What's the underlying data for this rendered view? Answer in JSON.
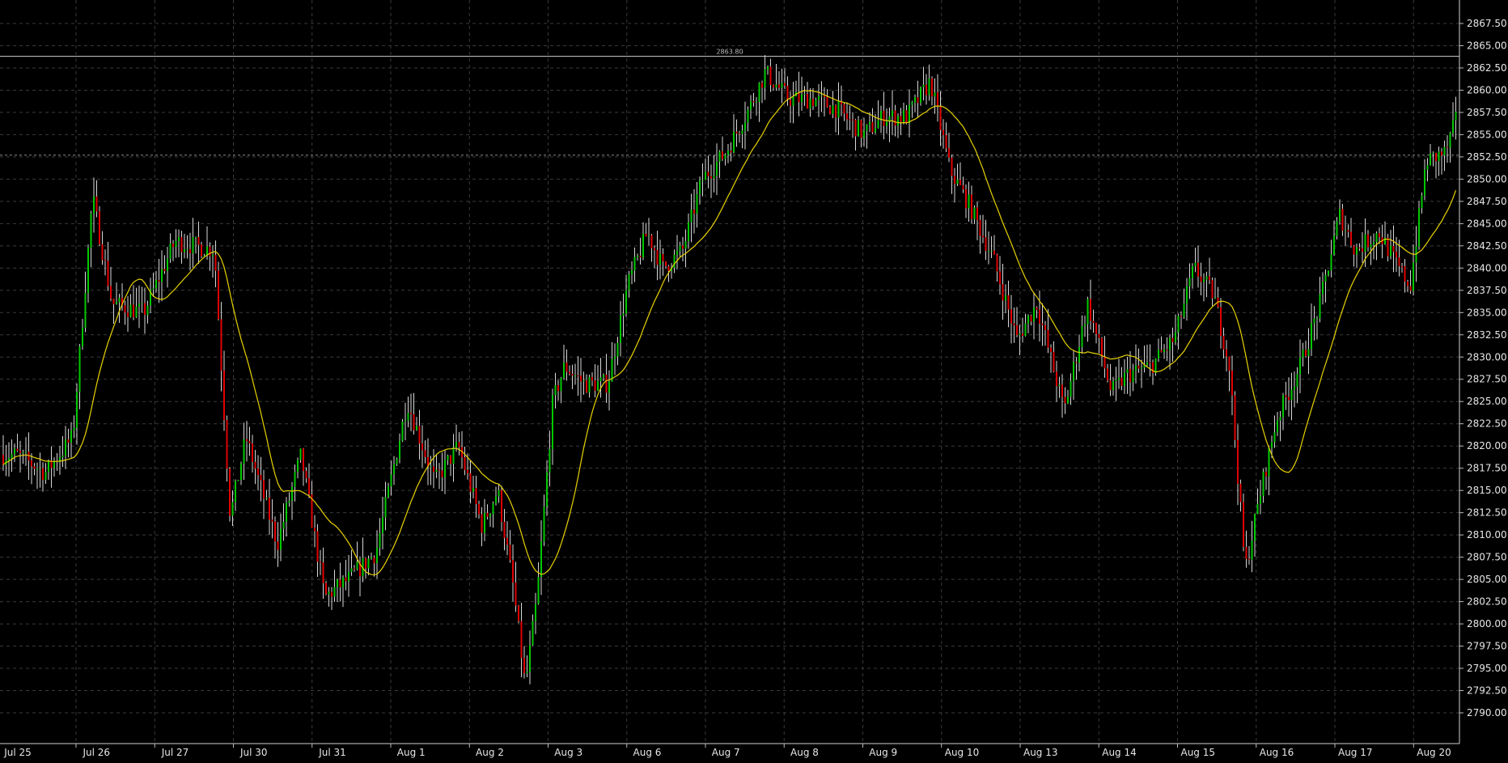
{
  "chart_data": {
    "type": "candlestick",
    "title": "",
    "xlabel": "",
    "ylabel": "",
    "ylim": [
      2787.5,
      2867.5
    ],
    "y_ticks": [
      2790.0,
      2792.5,
      2795.0,
      2797.5,
      2800.0,
      2802.5,
      2805.0,
      2807.5,
      2810.0,
      2812.5,
      2815.0,
      2817.5,
      2820.0,
      2822.5,
      2825.0,
      2827.5,
      2830.0,
      2832.5,
      2835.0,
      2837.5,
      2840.0,
      2842.5,
      2845.0,
      2847.5,
      2850.0,
      2852.5,
      2855.0,
      2857.5,
      2860.0,
      2862.5,
      2865.0,
      2867.5
    ],
    "y_tick_labels": [
      "2790.00",
      "2792.50",
      "2795.00",
      "2797.50",
      "2800.00",
      "2802.50",
      "2805.00",
      "2807.50",
      "2810.00",
      "2812.50",
      "2815.00",
      "2817.50",
      "2820.00",
      "2822.50",
      "2825.00",
      "2827.50",
      "2830.00",
      "2832.50",
      "2835.00",
      "2837.50",
      "2840.00",
      "2842.50",
      "2845.00",
      "2847.50",
      "2850.00",
      "2852.50",
      "2855.00",
      "2857.50",
      "2860.00",
      "2862.50",
      "2865.00",
      "2867.50"
    ],
    "x_labels": [
      "Jul 25",
      "Jul 26",
      "Jul 27",
      "Jul 30",
      "Jul 31",
      "Aug 1",
      "Aug 2",
      "Aug 3",
      "Aug 6",
      "Aug 7",
      "Aug 8",
      "Aug 9",
      "Aug 10",
      "Aug 13",
      "Aug 14",
      "Aug 15",
      "Aug 16",
      "Aug 17",
      "Aug 20"
    ],
    "reference_line": {
      "value": 2863.8,
      "label": "2863.80"
    },
    "dashed_line": {
      "value": 2852.7
    },
    "grid": true,
    "colors": {
      "background": "#000000",
      "grid": "#3a3a3a",
      "up": "#00c800",
      "down": "#e00000",
      "wick": "#d8d8d8",
      "ma": "#e8d200",
      "axis_text": "#e6e6e6",
      "reference": "#cfcfcf"
    },
    "price_path": [
      [
        0,
        2819
      ],
      [
        0.35,
        2817
      ],
      [
        0.7,
        2821
      ],
      [
        0.95,
        2848
      ],
      [
        1.2,
        2836
      ],
      [
        1.6,
        2835
      ],
      [
        2.0,
        2843
      ],
      [
        2.5,
        2842
      ],
      [
        2.7,
        2812
      ],
      [
        2.9,
        2821
      ],
      [
        3.3,
        2809
      ],
      [
        3.6,
        2819
      ],
      [
        3.9,
        2803
      ],
      [
        4.2,
        2805
      ],
      [
        4.55,
        2808
      ],
      [
        4.95,
        2825
      ],
      [
        5.3,
        2816
      ],
      [
        5.6,
        2820
      ],
      [
        5.9,
        2811
      ],
      [
        6.1,
        2815
      ],
      [
        6.3,
        2804
      ],
      [
        6.45,
        2793
      ],
      [
        6.6,
        2803
      ],
      [
        6.8,
        2825
      ],
      [
        6.95,
        2829
      ],
      [
        7.2,
        2827
      ],
      [
        7.5,
        2827
      ],
      [
        7.75,
        2838
      ],
      [
        8.0,
        2844
      ],
      [
        8.2,
        2840
      ],
      [
        8.45,
        2842
      ],
      [
        8.7,
        2850
      ],
      [
        9.0,
        2853
      ],
      [
        9.3,
        2858
      ],
      [
        9.5,
        2862
      ],
      [
        9.8,
        2859
      ],
      [
        10.1,
        2859
      ],
      [
        10.4,
        2858
      ],
      [
        10.75,
        2855
      ],
      [
        11.0,
        2857
      ],
      [
        11.3,
        2857
      ],
      [
        11.6,
        2861
      ],
      [
        11.85,
        2851
      ],
      [
        12.1,
        2847
      ],
      [
        12.4,
        2841
      ],
      [
        12.7,
        2832
      ],
      [
        12.95,
        2836
      ],
      [
        13.3,
        2824
      ],
      [
        13.6,
        2836
      ],
      [
        13.9,
        2826
      ],
      [
        14.1,
        2828
      ],
      [
        14.4,
        2829
      ],
      [
        14.7,
        2832
      ],
      [
        14.95,
        2840
      ],
      [
        15.2,
        2837
      ],
      [
        15.4,
        2829
      ],
      [
        15.6,
        2806
      ],
      [
        15.8,
        2815
      ],
      [
        16.0,
        2823
      ],
      [
        16.3,
        2829
      ],
      [
        16.55,
        2836
      ],
      [
        16.8,
        2846
      ],
      [
        17.0,
        2842
      ],
      [
        17.3,
        2844
      ],
      [
        17.55,
        2840
      ],
      [
        17.7,
        2838
      ],
      [
        17.9,
        2852
      ],
      [
        18.15,
        2853
      ],
      [
        18.4,
        2860
      ],
      [
        18.6,
        2857
      ],
      [
        18.75,
        2856
      ]
    ]
  }
}
